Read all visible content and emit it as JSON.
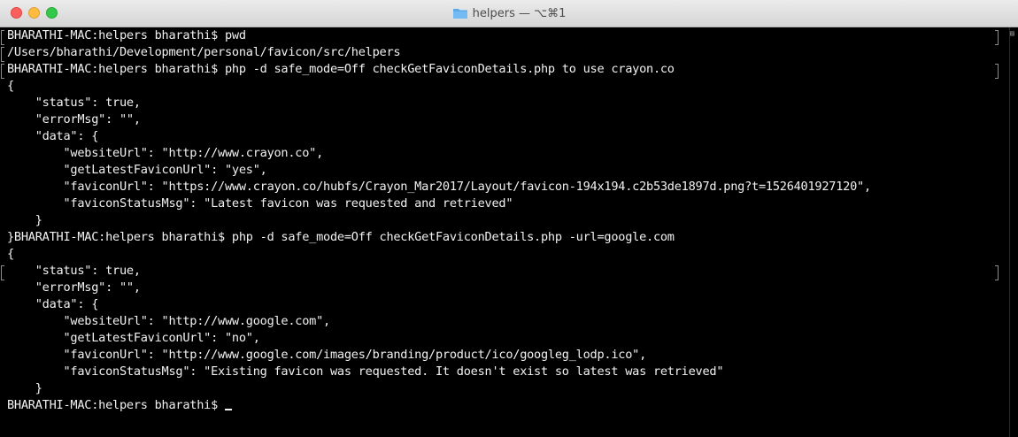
{
  "window": {
    "title": "helpers — ⌥⌘1",
    "folder_icon": "folder-icon"
  },
  "terminal": {
    "lines": [
      "BHARATHI-MAC:helpers bharathi$ pwd",
      "/Users/bharathi/Development/personal/favicon/src/helpers",
      "BHARATHI-MAC:helpers bharathi$ php -d safe_mode=Off checkGetFaviconDetails.php to use crayon.co",
      "{",
      "    \"status\": true,",
      "    \"errorMsg\": \"\",",
      "    \"data\": {",
      "        \"websiteUrl\": \"http://www.crayon.co\",",
      "        \"getLatestFaviconUrl\": \"yes\",",
      "        \"faviconUrl\": \"https://www.crayon.co/hubfs/Crayon_Mar2017/Layout/favicon-194x194.c2b53de1897d.png?t=1526401927120\",",
      "        \"faviconStatusMsg\": \"Latest favicon was requested and retrieved\"",
      "    }",
      "}BHARATHI-MAC:helpers bharathi$ php -d safe_mode=Off checkGetFaviconDetails.php -url=google.com",
      "{",
      "    \"status\": true,",
      "    \"errorMsg\": \"\",",
      "    \"data\": {",
      "        \"websiteUrl\": \"http://www.google.com\",",
      "        \"getLatestFaviconUrl\": \"no\",",
      "        \"faviconUrl\": \"http://www.google.com/images/branding/product/ico/googleg_lodp.ico\",",
      "        \"faviconStatusMsg\": \"Existing favicon was requested. It doesn't exist so latest was retrieved\"",
      "    }",
      "BHARATHI-MAC:helpers bharathi$ "
    ]
  }
}
